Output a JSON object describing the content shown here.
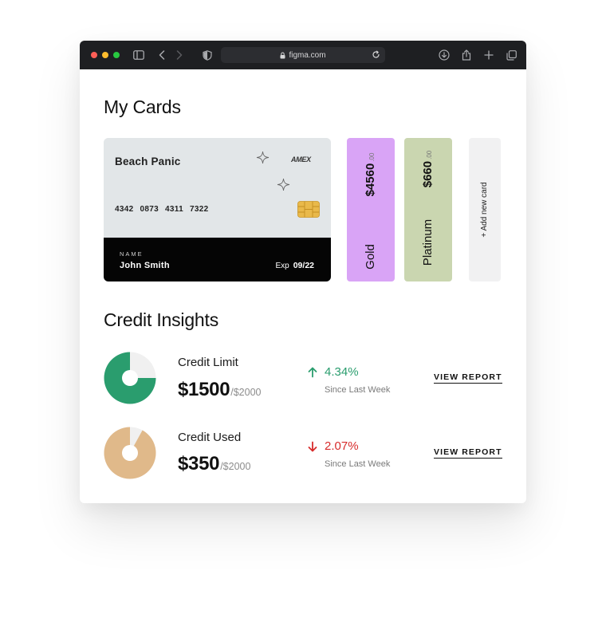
{
  "browser": {
    "url": "figma.com",
    "icons": [
      "sidebar-icon",
      "back-icon",
      "forward-icon",
      "shield-icon",
      "lock-icon",
      "reload-icon",
      "download-icon",
      "share-icon",
      "new-tab-icon",
      "tabs-overview-icon"
    ]
  },
  "page": {
    "cards_title": "My Cards",
    "insights_title": "Credit Insights"
  },
  "main_card": {
    "name": "Beach Panic",
    "brand": "AMEX",
    "number": "4342 0873 4311 7322",
    "holder_label": "NAME",
    "holder": "John Smith",
    "exp_label": "Exp",
    "exp": "09/22",
    "colors": {
      "top": "#e2e6e8",
      "bottom": "#050505"
    }
  },
  "cards": [
    {
      "tier": "Gold",
      "amount": "$4560",
      "cents": ".00",
      "color": "#d9a4f6"
    },
    {
      "tier": "Platinum",
      "amount": "$660",
      "cents": ".00",
      "color": "#cad6b0"
    }
  ],
  "add_card": {
    "label": "+ Add new card"
  },
  "insights": [
    {
      "label": "Credit Limit",
      "value": "$1500",
      "of": "/$2000",
      "change": "4.34%",
      "direction": "up",
      "since": "Since Last Week",
      "report": "VIEW REPORT",
      "fraction": 0.75,
      "color": "#2a9d6e"
    },
    {
      "label": "Credit Used",
      "value": "$350",
      "of": "/$2000",
      "change": "2.07%",
      "direction": "down",
      "since": "Since Last Week",
      "report": "VIEW REPORT",
      "fraction": 0.92,
      "color": "#e0b98a"
    }
  ]
}
